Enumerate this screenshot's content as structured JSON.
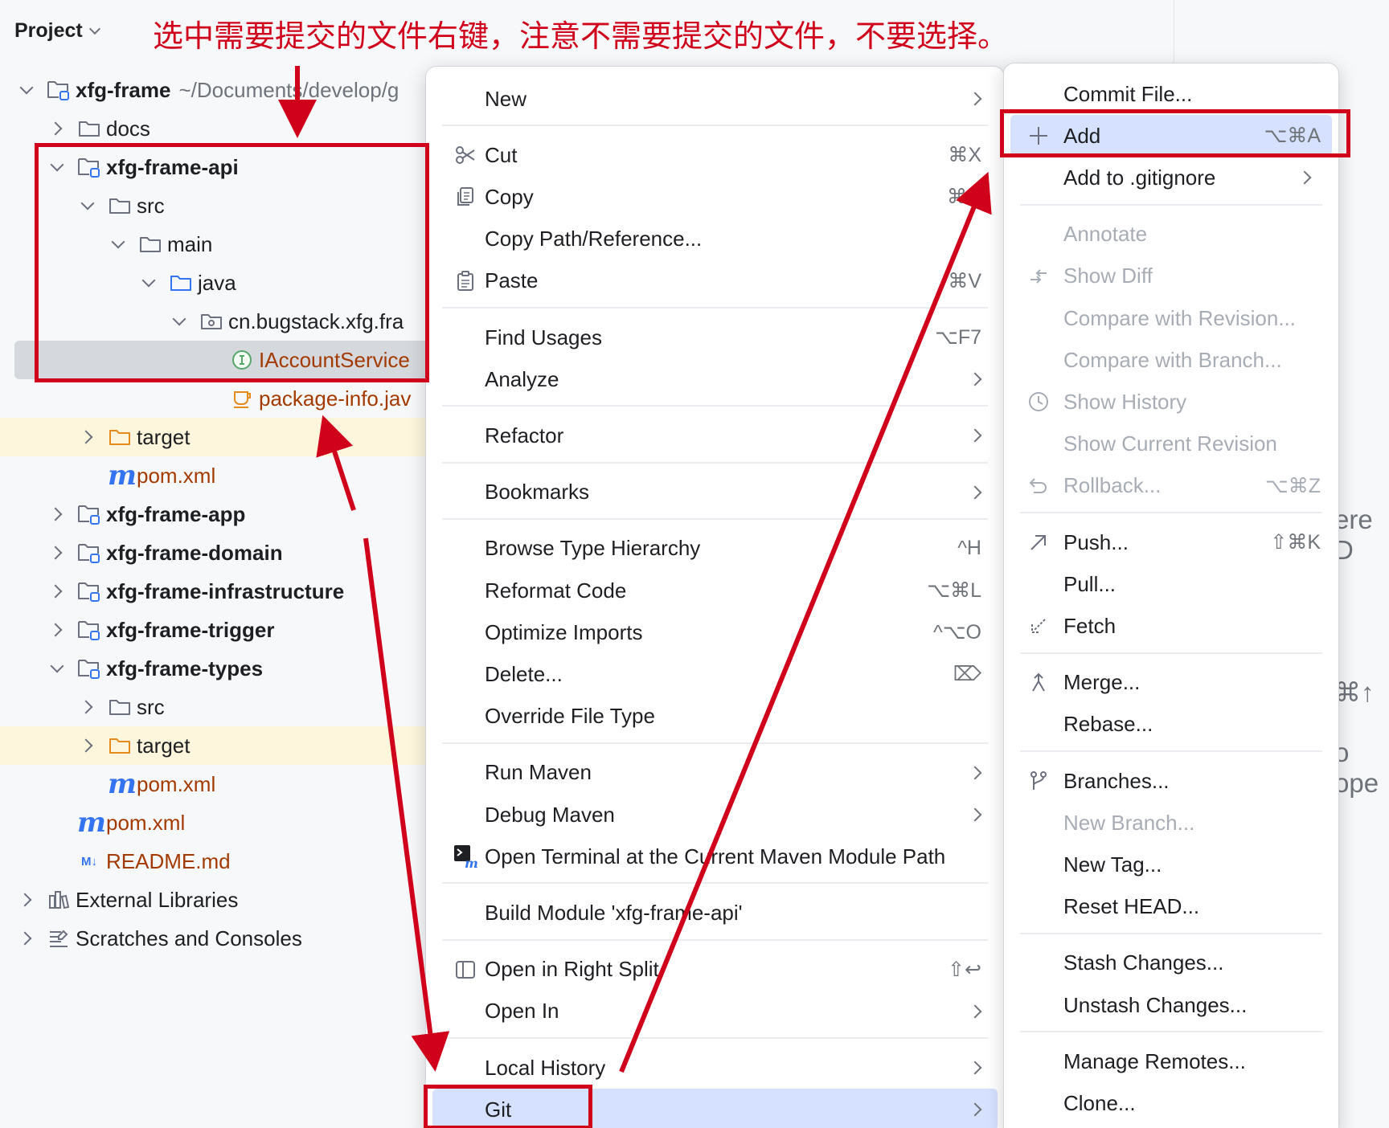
{
  "annotation": "选中需要提交的文件右键，注意不需要提交的文件，不要选择。",
  "project": {
    "header": "Project",
    "tree": [
      {
        "label": "xfg-frame",
        "path": "~/Documents/develop/g",
        "icon": "module-folder-icon",
        "bold": true,
        "toggle": "down",
        "indent": 0
      },
      {
        "label": "docs",
        "icon": "folder-icon",
        "toggle": "right",
        "indent": 1
      },
      {
        "label": "xfg-frame-api",
        "icon": "module-folder-icon",
        "bold": true,
        "toggle": "down",
        "indent": 1
      },
      {
        "label": "src",
        "icon": "folder-icon",
        "toggle": "down",
        "indent": 2
      },
      {
        "label": "main",
        "icon": "folder-icon",
        "toggle": "down",
        "indent": 3
      },
      {
        "label": "java",
        "icon": "source-folder-icon",
        "toggle": "down",
        "indent": 4
      },
      {
        "label": "cn.bugstack.xfg.fra",
        "icon": "package-icon",
        "toggle": "down",
        "indent": 5
      },
      {
        "label": "IAccountService",
        "icon": "interface-icon",
        "orange": true,
        "toggle": "none",
        "indent": 6,
        "selected": true
      },
      {
        "label": "package-info.jav",
        "icon": "java-file-icon",
        "orange": true,
        "toggle": "none",
        "indent": 6
      },
      {
        "label": "target",
        "icon": "excluded-folder-icon",
        "toggle": "right",
        "indent": 2,
        "excluded": true
      },
      {
        "label": "pom.xml",
        "icon": "maven-icon",
        "orange": true,
        "toggle": "none",
        "indent": 2
      },
      {
        "label": "xfg-frame-app",
        "icon": "module-folder-icon",
        "bold": true,
        "toggle": "right",
        "indent": 1
      },
      {
        "label": "xfg-frame-domain",
        "icon": "module-folder-icon",
        "bold": true,
        "toggle": "right",
        "indent": 1
      },
      {
        "label": "xfg-frame-infrastructure",
        "icon": "module-folder-icon",
        "bold": true,
        "toggle": "right",
        "indent": 1
      },
      {
        "label": "xfg-frame-trigger",
        "icon": "module-folder-icon",
        "bold": true,
        "toggle": "right",
        "indent": 1
      },
      {
        "label": "xfg-frame-types",
        "icon": "module-folder-icon",
        "bold": true,
        "toggle": "down",
        "indent": 1
      },
      {
        "label": "src",
        "icon": "folder-icon",
        "toggle": "right",
        "indent": 2
      },
      {
        "label": "target",
        "icon": "excluded-folder-icon",
        "toggle": "right",
        "indent": 2,
        "excluded": true
      },
      {
        "label": "pom.xml",
        "icon": "maven-icon",
        "orange": true,
        "toggle": "none",
        "indent": 2
      },
      {
        "label": "pom.xml",
        "icon": "maven-icon",
        "orange": true,
        "toggle": "none",
        "indent": 1
      },
      {
        "label": "README.md",
        "icon": "markdown-icon",
        "orange": true,
        "toggle": "none",
        "indent": 1
      },
      {
        "label": "External Libraries",
        "icon": "library-icon",
        "toggle": "right",
        "indent": 0
      },
      {
        "label": "Scratches and Consoles",
        "icon": "scratches-icon",
        "toggle": "right",
        "indent": 0
      }
    ]
  },
  "background_text": {
    "t1": "ere D",
    "t2": "⌘↑",
    "t3": "o ope"
  },
  "context_menu": {
    "items": [
      {
        "label": "New",
        "arrow": true
      },
      {
        "sep": true
      },
      {
        "label": "Cut",
        "shortcut": "⌘X",
        "icon": "scissors-icon"
      },
      {
        "label": "Copy",
        "shortcut": "⌘C",
        "icon": "copy-icon"
      },
      {
        "label": "Copy Path/Reference..."
      },
      {
        "label": "Paste",
        "shortcut": "⌘V",
        "icon": "paste-icon"
      },
      {
        "sep": true
      },
      {
        "label": "Find Usages",
        "shortcut": "⌥F7"
      },
      {
        "label": "Analyze",
        "arrow": true
      },
      {
        "sep": true
      },
      {
        "label": "Refactor",
        "arrow": true
      },
      {
        "sep": true
      },
      {
        "label": "Bookmarks",
        "arrow": true
      },
      {
        "sep": true
      },
      {
        "label": "Browse Type Hierarchy",
        "shortcut": "^H"
      },
      {
        "label": "Reformat Code",
        "shortcut": "⌥⌘L"
      },
      {
        "label": "Optimize Imports",
        "shortcut": "^⌥O"
      },
      {
        "label": "Delete...",
        "shortcut": "⌦"
      },
      {
        "label": "Override File Type"
      },
      {
        "sep": true
      },
      {
        "label": "Run Maven",
        "arrow": true
      },
      {
        "label": "Debug Maven",
        "arrow": true
      },
      {
        "label": "Open Terminal at the Current Maven Module Path",
        "icon": "terminal-maven-icon"
      },
      {
        "sep": true
      },
      {
        "label": "Build Module 'xfg-frame-api'"
      },
      {
        "sep": true
      },
      {
        "label": "Open in Right Split",
        "shortcut": "⇧↩",
        "icon": "split-icon"
      },
      {
        "label": "Open In",
        "arrow": true
      },
      {
        "sep": true
      },
      {
        "label": "Local History",
        "arrow": true
      },
      {
        "label": "Git",
        "arrow": true,
        "highlighted": true
      }
    ]
  },
  "git_submenu": {
    "items": [
      {
        "label": "Commit File..."
      },
      {
        "label": "Add",
        "shortcut": "⌥⌘A",
        "icon": "plus-icon",
        "highlighted": true
      },
      {
        "label": "Add to .gitignore",
        "arrow": true
      },
      {
        "sep": true
      },
      {
        "label": "Annotate",
        "disabled": true
      },
      {
        "label": "Show Diff",
        "disabled": true,
        "icon": "diff-icon"
      },
      {
        "label": "Compare with Revision...",
        "disabled": true
      },
      {
        "label": "Compare with Branch...",
        "disabled": true
      },
      {
        "label": "Show History",
        "disabled": true,
        "icon": "history-icon"
      },
      {
        "label": "Show Current Revision",
        "disabled": true
      },
      {
        "label": "Rollback...",
        "shortcut": "⌥⌘Z",
        "disabled": true,
        "icon": "rollback-icon"
      },
      {
        "sep": true
      },
      {
        "label": "Push...",
        "shortcut": "⇧⌘K",
        "icon": "push-icon"
      },
      {
        "label": "Pull..."
      },
      {
        "label": "Fetch",
        "icon": "fetch-icon"
      },
      {
        "sep": true
      },
      {
        "label": "Merge...",
        "icon": "merge-icon"
      },
      {
        "label": "Rebase..."
      },
      {
        "sep": true
      },
      {
        "label": "Branches...",
        "icon": "branch-icon"
      },
      {
        "label": "New Branch...",
        "disabled": true
      },
      {
        "label": "New Tag..."
      },
      {
        "label": "Reset HEAD..."
      },
      {
        "sep": true
      },
      {
        "label": "Stash Changes..."
      },
      {
        "label": "Unstash Changes..."
      },
      {
        "sep": true
      },
      {
        "label": "Manage Remotes..."
      },
      {
        "label": "Clone..."
      }
    ]
  },
  "colors": {
    "annotation_red": "#d0021b",
    "selection_blue": "#d5e1ff",
    "accent": "#3574f0"
  }
}
